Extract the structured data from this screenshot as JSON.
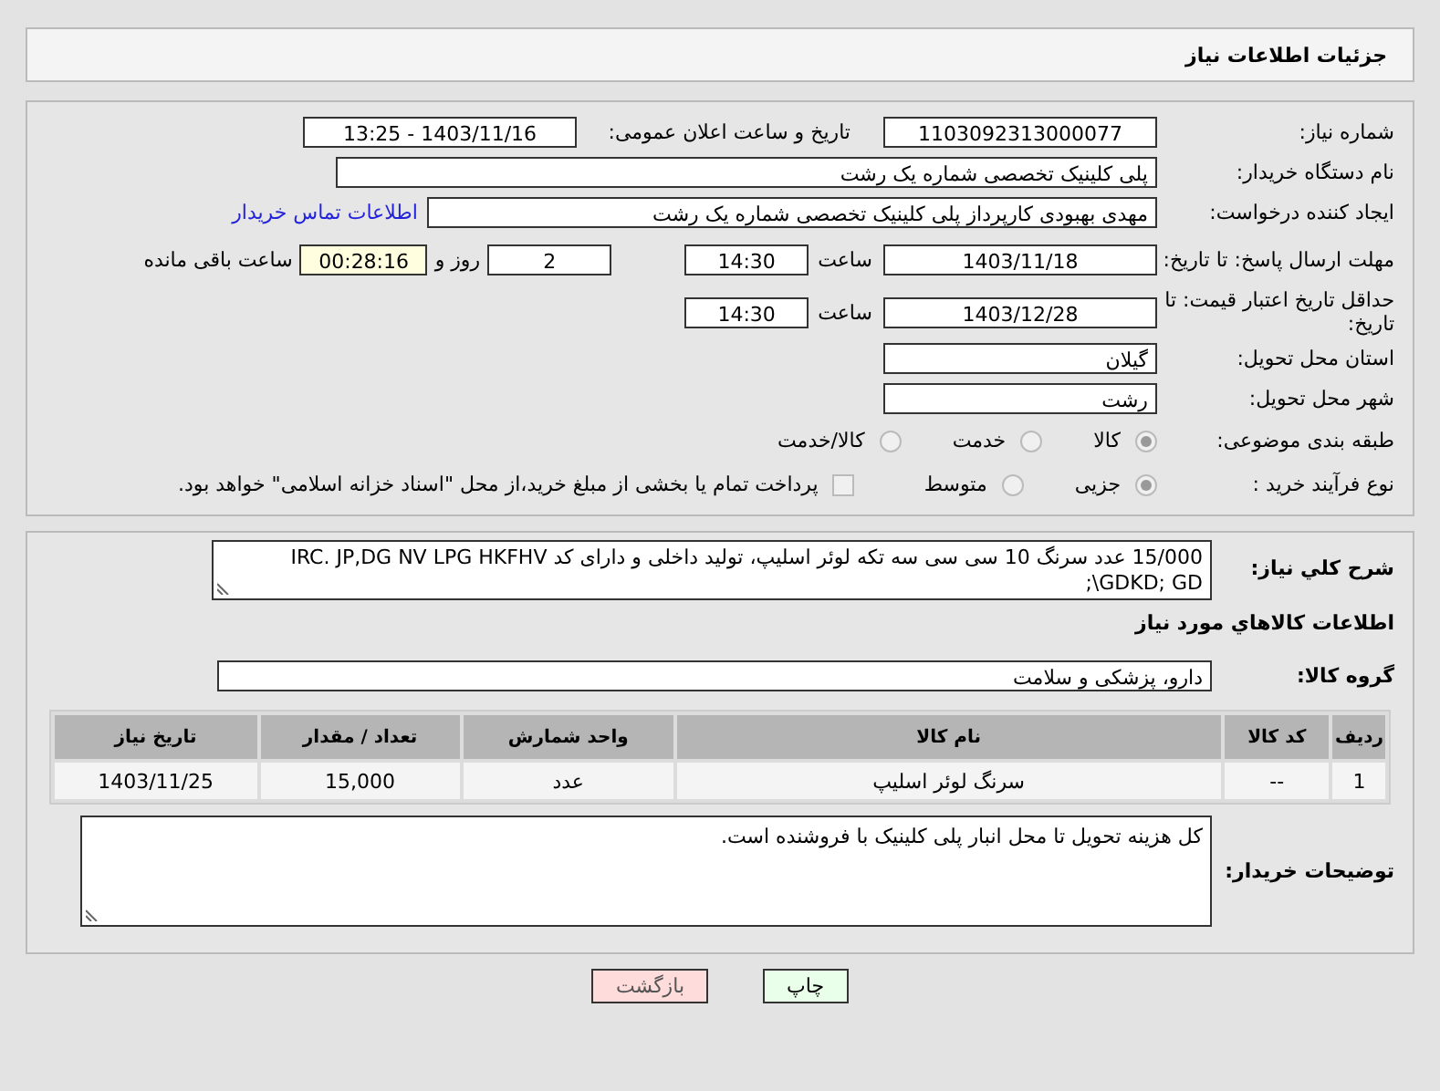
{
  "page_title": "جزئیات اطلاعات نیاز",
  "need_number": {
    "label": "شماره نیاز:",
    "value": "1103092313000077"
  },
  "announce": {
    "label": "تاریخ و ساعت اعلان عمومی:",
    "value": "1403/11/16 - 13:25"
  },
  "buyer_org": {
    "label": "نام دستگاه خریدار:",
    "value": "پلی کلینیک تخصصی شماره یک رشت"
  },
  "requester": {
    "label": "ایجاد کننده درخواست:",
    "value": "مهدی بهبودی کارپرداز پلی کلینیک تخصصی شماره یک رشت",
    "contact_link": "اطلاعات تماس خریدار"
  },
  "reply_deadline": {
    "label": "مهلت ارسال پاسخ: تا تاریخ:",
    "date": "1403/11/18",
    "time_label": "ساعت",
    "time": "14:30",
    "days": "2",
    "days_label": "روز و",
    "remaining": "00:28:16",
    "remaining_label": "ساعت باقی مانده"
  },
  "price_validity": {
    "label": "حداقل تاریخ اعتبار قیمت: تا تاریخ:",
    "date": "1403/12/28",
    "time_label": "ساعت",
    "time": "14:30"
  },
  "province": {
    "label": "استان محل تحویل:",
    "value": "گیلان"
  },
  "city": {
    "label": "شهر محل تحویل:",
    "value": "رشت"
  },
  "category": {
    "label": "طبقه بندی موضوعی:",
    "options": [
      {
        "label": "کالا",
        "selected": true
      },
      {
        "label": "خدمت",
        "selected": false
      },
      {
        "label": "کالا/خدمت",
        "selected": false
      }
    ]
  },
  "process": {
    "label": "نوع فرآیند خرید :",
    "options": [
      {
        "label": "جزیی",
        "selected": true
      },
      {
        "label": "متوسط",
        "selected": false
      }
    ],
    "payment": {
      "label": "پرداخت تمام یا بخشی از مبلغ خرید،از محل \"اسناد خزانه اسلامی\" خواهد بود.",
      "checked": false
    }
  },
  "description": {
    "label": "شرح کلي نياز:",
    "value": "15/000 عدد سرنگ 10 سی سی سه تکه لوئر اسلیپ، تولید داخلی و دارای کد IRC. JP,DG NV LPG HKFHV GDKD; GD\\;"
  },
  "items_heading": "اطلاعات کالاهاي مورد نياز",
  "goods_group": {
    "label": "گروه کالا:",
    "value": "دارو، پزشکی و سلامت"
  },
  "table": {
    "columns": [
      "ردیف",
      "کد کالا",
      "نام کالا",
      "واحد شمارش",
      "تعداد / مقدار",
      "تاریخ نیاز"
    ],
    "rows": [
      [
        "1",
        "--",
        "سرنگ لوئر اسلیپ",
        "عدد",
        "15,000",
        "1403/11/25"
      ]
    ]
  },
  "buyer_notes": {
    "label": "توضیحات خریدار:",
    "value": "کل هزینه تحویل تا محل انبار پلی کلینیک با فروشنده است."
  },
  "buttons": [
    {
      "label": "چاپ",
      "kind": "print"
    },
    {
      "label": "بازگشت",
      "kind": "back"
    }
  ]
}
